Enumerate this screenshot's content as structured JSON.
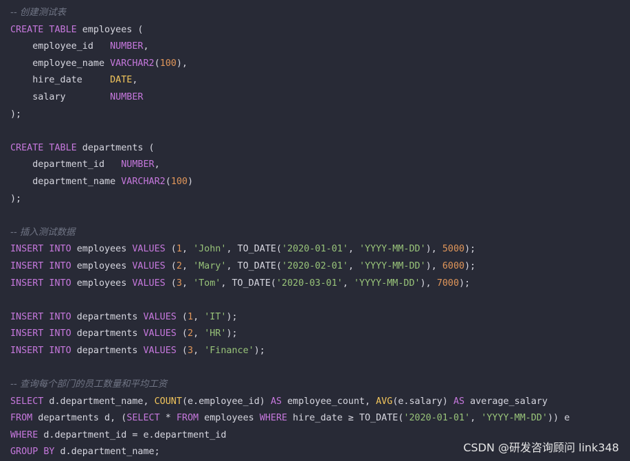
{
  "colors": {
    "background": "#282a36",
    "keyword": "#c678dd",
    "identifier": "#d7d7e0",
    "function": "#f2c55c",
    "string": "#98c379",
    "number": "#e0965a",
    "comment": "#707585"
  },
  "lines": [
    [
      [
        "com",
        "-- 创建测试表"
      ]
    ],
    [
      [
        "kw",
        "CREATE TABLE"
      ],
      [
        "id",
        " employees ("
      ]
    ],
    [
      [
        "id",
        "    employee_id   "
      ],
      [
        "kw",
        "NUMBER"
      ],
      [
        "id",
        ","
      ]
    ],
    [
      [
        "id",
        "    employee_name "
      ],
      [
        "kw",
        "VARCHAR2"
      ],
      [
        "id",
        "("
      ],
      [
        "num",
        "100"
      ],
      [
        "id",
        "),"
      ]
    ],
    [
      [
        "id",
        "    hire_date     "
      ],
      [
        "fn",
        "DATE"
      ],
      [
        "id",
        ","
      ]
    ],
    [
      [
        "id",
        "    salary        "
      ],
      [
        "kw",
        "NUMBER"
      ]
    ],
    [
      [
        "id",
        ");"
      ]
    ],
    [],
    [
      [
        "kw",
        "CREATE TABLE"
      ],
      [
        "id",
        " departments ("
      ]
    ],
    [
      [
        "id",
        "    department_id   "
      ],
      [
        "kw",
        "NUMBER"
      ],
      [
        "id",
        ","
      ]
    ],
    [
      [
        "id",
        "    department_name "
      ],
      [
        "kw",
        "VARCHAR2"
      ],
      [
        "id",
        "("
      ],
      [
        "num",
        "100"
      ],
      [
        "id",
        ")"
      ]
    ],
    [
      [
        "id",
        ");"
      ]
    ],
    [],
    [
      [
        "com",
        "-- 插入测试数据"
      ]
    ],
    [
      [
        "kw",
        "INSERT INTO"
      ],
      [
        "id",
        " employees "
      ],
      [
        "kw",
        "VALUES"
      ],
      [
        "id",
        " ("
      ],
      [
        "num",
        "1"
      ],
      [
        "id",
        ", "
      ],
      [
        "str",
        "'John'"
      ],
      [
        "id",
        ", TO_DATE("
      ],
      [
        "str",
        "'2020-01-01'"
      ],
      [
        "id",
        ", "
      ],
      [
        "str",
        "'YYYY-MM-DD'"
      ],
      [
        "id",
        "), "
      ],
      [
        "num",
        "5000"
      ],
      [
        "id",
        ");"
      ]
    ],
    [
      [
        "kw",
        "INSERT INTO"
      ],
      [
        "id",
        " employees "
      ],
      [
        "kw",
        "VALUES"
      ],
      [
        "id",
        " ("
      ],
      [
        "num",
        "2"
      ],
      [
        "id",
        ", "
      ],
      [
        "str",
        "'Mary'"
      ],
      [
        "id",
        ", TO_DATE("
      ],
      [
        "str",
        "'2020-02-01'"
      ],
      [
        "id",
        ", "
      ],
      [
        "str",
        "'YYYY-MM-DD'"
      ],
      [
        "id",
        "), "
      ],
      [
        "num",
        "6000"
      ],
      [
        "id",
        ");"
      ]
    ],
    [
      [
        "kw",
        "INSERT INTO"
      ],
      [
        "id",
        " employees "
      ],
      [
        "kw",
        "VALUES"
      ],
      [
        "id",
        " ("
      ],
      [
        "num",
        "3"
      ],
      [
        "id",
        ", "
      ],
      [
        "str",
        "'Tom'"
      ],
      [
        "id",
        ", TO_DATE("
      ],
      [
        "str",
        "'2020-03-01'"
      ],
      [
        "id",
        ", "
      ],
      [
        "str",
        "'YYYY-MM-DD'"
      ],
      [
        "id",
        "), "
      ],
      [
        "num",
        "7000"
      ],
      [
        "id",
        ");"
      ]
    ],
    [],
    [
      [
        "kw",
        "INSERT INTO"
      ],
      [
        "id",
        " departments "
      ],
      [
        "kw",
        "VALUES"
      ],
      [
        "id",
        " ("
      ],
      [
        "num",
        "1"
      ],
      [
        "id",
        ", "
      ],
      [
        "str",
        "'IT'"
      ],
      [
        "id",
        ");"
      ]
    ],
    [
      [
        "kw",
        "INSERT INTO"
      ],
      [
        "id",
        " departments "
      ],
      [
        "kw",
        "VALUES"
      ],
      [
        "id",
        " ("
      ],
      [
        "num",
        "2"
      ],
      [
        "id",
        ", "
      ],
      [
        "str",
        "'HR'"
      ],
      [
        "id",
        ");"
      ]
    ],
    [
      [
        "kw",
        "INSERT INTO"
      ],
      [
        "id",
        " departments "
      ],
      [
        "kw",
        "VALUES"
      ],
      [
        "id",
        " ("
      ],
      [
        "num",
        "3"
      ],
      [
        "id",
        ", "
      ],
      [
        "str",
        "'Finance'"
      ],
      [
        "id",
        ");"
      ]
    ],
    [],
    [
      [
        "com",
        "-- 查询每个部门的员工数量和平均工资"
      ]
    ],
    [
      [
        "kw",
        "SELECT"
      ],
      [
        "id",
        " d.department_name, "
      ],
      [
        "fn",
        "COUNT"
      ],
      [
        "id",
        "(e.employee_id) "
      ],
      [
        "kw",
        "AS"
      ],
      [
        "id",
        " employee_count, "
      ],
      [
        "fn",
        "AVG"
      ],
      [
        "id",
        "(e.salary) "
      ],
      [
        "kw",
        "AS"
      ],
      [
        "id",
        " average_salary"
      ]
    ],
    [
      [
        "kw",
        "FROM"
      ],
      [
        "id",
        " departments d, ("
      ],
      [
        "kw",
        "SELECT"
      ],
      [
        "id",
        " * "
      ],
      [
        "kw",
        "FROM"
      ],
      [
        "id",
        " employees "
      ],
      [
        "kw",
        "WHERE"
      ],
      [
        "id",
        " hire_date ≥ TO_DATE("
      ],
      [
        "str",
        "'2020-01-01'"
      ],
      [
        "id",
        ", "
      ],
      [
        "str",
        "'YYYY-MM-DD'"
      ],
      [
        "id",
        "))"
      ],
      [
        "id",
        " e"
      ]
    ],
    [
      [
        "kw",
        "WHERE"
      ],
      [
        "id",
        " d.department_id = e.department_id"
      ]
    ],
    [
      [
        "kw",
        "GROUP BY"
      ],
      [
        "id",
        " d.department_name;"
      ]
    ]
  ],
  "watermark": "CSDN @研发咨询顾问 link348"
}
